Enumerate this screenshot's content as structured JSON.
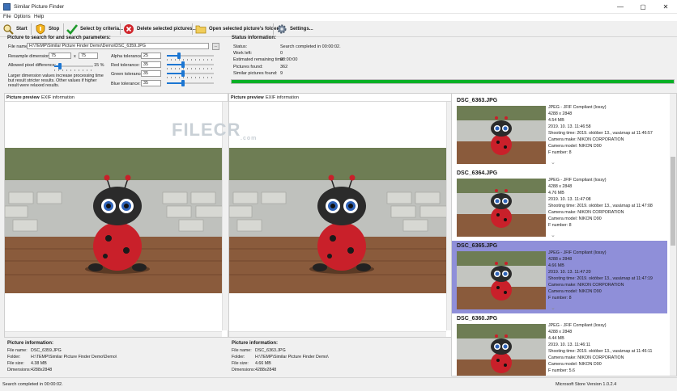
{
  "window": {
    "title": "Similar Picture Finder",
    "minimize": "—",
    "maximize": "▢",
    "close": "✕"
  },
  "menu": [
    "File",
    "Options",
    "Help"
  ],
  "toolbar": {
    "start": "Start",
    "stop": "Stop",
    "select_by_criteria": "Select by criteria...",
    "delete_selected": "Delete selected pictures...",
    "open_folder": "Open selected picture's folder",
    "settings": "Settings..."
  },
  "search_params": {
    "title": "Picture to search for and search parameters:",
    "file_name_label": "File name:",
    "file_name_value": "H:\\TEMP\\Similar Picture Finder Demo\\Demo\\DSC_6359.JPG",
    "browse": "...",
    "resample_label": "Resample dimensions:",
    "resample_w": "75",
    "resample_x": "x",
    "resample_h": "75",
    "allowed_diff_label": "Allowed pixel difference:",
    "allowed_diff_value": "15 %",
    "allowed_diff_level": 0.15,
    "note": "Larger dimension values increase processing time but result stricter results. Other values if higher result were relaxed results.",
    "tolerances": [
      {
        "label": "Alpha tolerance:",
        "value": "25",
        "level": 0.25
      },
      {
        "label": "Red tolerance:",
        "value": "35",
        "level": 0.35
      },
      {
        "label": "Green tolerance:",
        "value": "35",
        "level": 0.35
      },
      {
        "label": "Blue tolerance:",
        "value": "35",
        "level": 0.35
      }
    ]
  },
  "status": {
    "title": "Status information:",
    "rows": [
      {
        "label": "Status:",
        "value": "Search completed in 00:00:02."
      },
      {
        "label": "Work left:",
        "value": "0"
      },
      {
        "label": "Estimated remaining time:",
        "value": "00:00:00"
      },
      {
        "label": "Pictures found:",
        "value": "362"
      },
      {
        "label": "Similar pictures found:",
        "value": "9"
      }
    ],
    "progress": 1.0
  },
  "left_panel": {
    "tab_preview": "Picture preview",
    "tab_exif": "EXIF information",
    "info_title": "Picture information:",
    "info": [
      {
        "label": "File name:",
        "value": "DSC_6359.JPG"
      },
      {
        "label": "Folder:",
        "value": "H:\\TEMP\\Similar Picture Finder Demo\\Demo\\"
      },
      {
        "label": "File size:",
        "value": "4.38 MB"
      },
      {
        "label": "Dimensions:",
        "value": "4288x2848"
      }
    ]
  },
  "right_panel": {
    "tab_preview": "Picture preview",
    "tab_exif": "EXIF information",
    "info_title": "Picture information:",
    "info": [
      {
        "label": "File name:",
        "value": "DSC_6363.JPG"
      },
      {
        "label": "Folder:",
        "value": "H:\\TEMP\\Similar Picture Finder Demo\\"
      },
      {
        "label": "File size:",
        "value": "4.66 MB"
      },
      {
        "label": "Dimensions:",
        "value": "4288x2848"
      }
    ]
  },
  "results": [
    {
      "name": "DSC_6363.JPG",
      "lines": [
        "JPEG - JFIF Compliant (lossy)",
        "4288 x 2848",
        "4.54 MB",
        "2019. 10. 13. 11:46:58",
        "Shooting time: 2019. október 13., vasárnap at 11:46:57",
        "Camera make: NIKON CORPORATION",
        "Camera model: NIKON D90",
        "F number: 8"
      ],
      "selected": false
    },
    {
      "name": "DSC_6364.JPG",
      "lines": [
        "JPEG - JFIF Compliant (lossy)",
        "4288 x 2848",
        "4.76 MB",
        "2019. 10. 13. 11:47:08",
        "Shooting time: 2019. október 13., vasárnap at 11:47:08",
        "Camera make: NIKON CORPORATION",
        "Camera model: NIKON D90",
        "F number: 8"
      ],
      "selected": false
    },
    {
      "name": "DSC_6365.JPG",
      "lines": [
        "JPEG - JFIF Compliant (lossy)",
        "4288 x 2848",
        "4.66 MB",
        "2019. 10. 13. 11:47:20",
        "Shooting time: 2019. október 13., vasárnap at 11:47:19",
        "Camera make: NIKON CORPORATION",
        "Camera model: NIKON D90",
        "F number: 8"
      ],
      "selected": true
    },
    {
      "name": "DSC_6360.JPG",
      "lines": [
        "JPEG - JFIF Compliant (lossy)",
        "4288 x 2848",
        "4.44 MB",
        "2019. 10. 13. 11:46:11",
        "Shooting time: 2019. október 13., vasárnap at 11:46:11",
        "Camera make: NIKON CORPORATION",
        "Camera model: NIKON D90",
        "F number: 5.6"
      ],
      "selected": false
    }
  ],
  "statusbar": {
    "left": "Search completed in 00:00:02.",
    "right": "Microsoft Store Version 1.0.2.4"
  },
  "watermark": {
    "text": "FILECR",
    "sub": ".com"
  },
  "colors": {
    "progress": "#06b025",
    "selected_row": "#8f8fd9",
    "slider": "#1c76d2"
  }
}
